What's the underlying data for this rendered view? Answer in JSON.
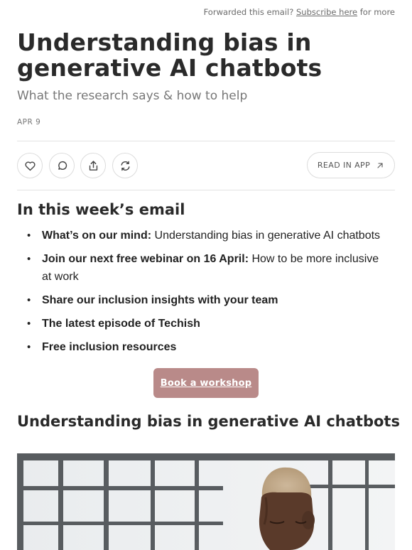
{
  "header": {
    "forwarded_prefix": "Forwarded this email?",
    "subscribe_link": "Subscribe here",
    "forwarded_suffix": "for more"
  },
  "post": {
    "title": "Understanding bias in generative AI chatbots",
    "subtitle": "What the research says & how to help",
    "date": "APR 9"
  },
  "actions": {
    "like_icon": "heart-icon",
    "comment_icon": "comment-icon",
    "share_icon": "share-icon",
    "restack_icon": "restack-icon",
    "read_in_app_label": "READ IN APP",
    "read_in_app_icon": "arrow-up-right-icon"
  },
  "week": {
    "heading": "In this week’s email",
    "items": [
      {
        "bold": "What’s on our mind:",
        "text": " Understanding bias in generative AI chatbots"
      },
      {
        "bold": "Join our next free webinar on 16 April:",
        "text": " How to be more inclusive at work"
      },
      {
        "bold": "Share our inclusion insights with your team",
        "text": ""
      },
      {
        "bold": "The latest episode of Techish",
        "text": ""
      },
      {
        "bold": "Free inclusion resources",
        "text": ""
      }
    ]
  },
  "cta": {
    "label": "Book a workshop",
    "color": "#b98a89"
  },
  "section": {
    "heading": "Understanding bias in generative AI chatbots"
  }
}
